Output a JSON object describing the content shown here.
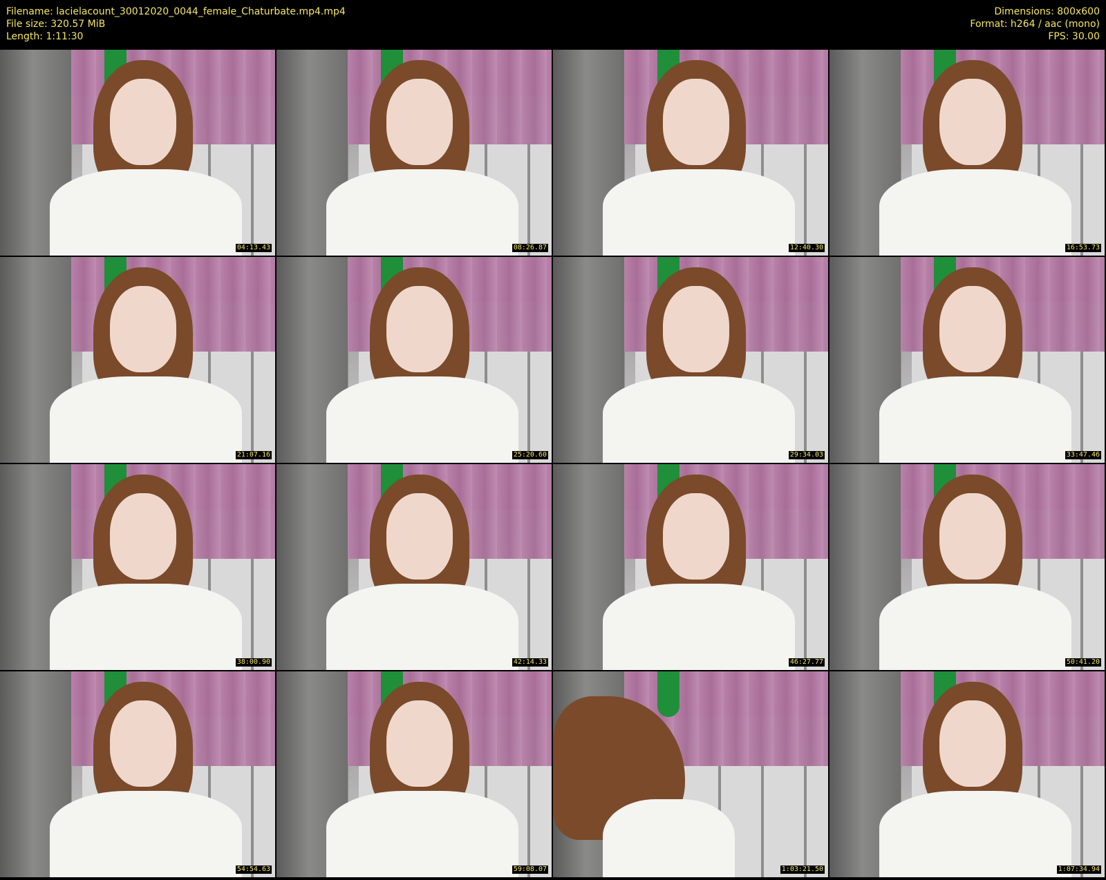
{
  "header": {
    "filename": "Filename: lacielacount_30012020_0044_female_Chaturbate.mp4.mp4",
    "filesize": "File size: 320.57 MiB",
    "length": "Length: 1:11:30",
    "dimensions": "Dimensions: 800x600",
    "format": "Format: h264 / aac (mono)",
    "fps": "FPS: 30.00"
  },
  "thumbnails": [
    {
      "timestamp": "04:13.43"
    },
    {
      "timestamp": "08:26.87"
    },
    {
      "timestamp": "12:40.30"
    },
    {
      "timestamp": "16:53.73"
    },
    {
      "timestamp": "21:07.16"
    },
    {
      "timestamp": "25:20.60"
    },
    {
      "timestamp": "29:34.03"
    },
    {
      "timestamp": "33:47.46"
    },
    {
      "timestamp": "38:00.90"
    },
    {
      "timestamp": "42:14.33"
    },
    {
      "timestamp": "46:27.77"
    },
    {
      "timestamp": "50:41.20"
    },
    {
      "timestamp": "54:54.63"
    },
    {
      "timestamp": "59:08.07"
    },
    {
      "timestamp": "1:03:21.50"
    },
    {
      "timestamp": "1:07:34.94"
    }
  ],
  "colors": {
    "background": "#000000",
    "text": "#f5e663"
  }
}
